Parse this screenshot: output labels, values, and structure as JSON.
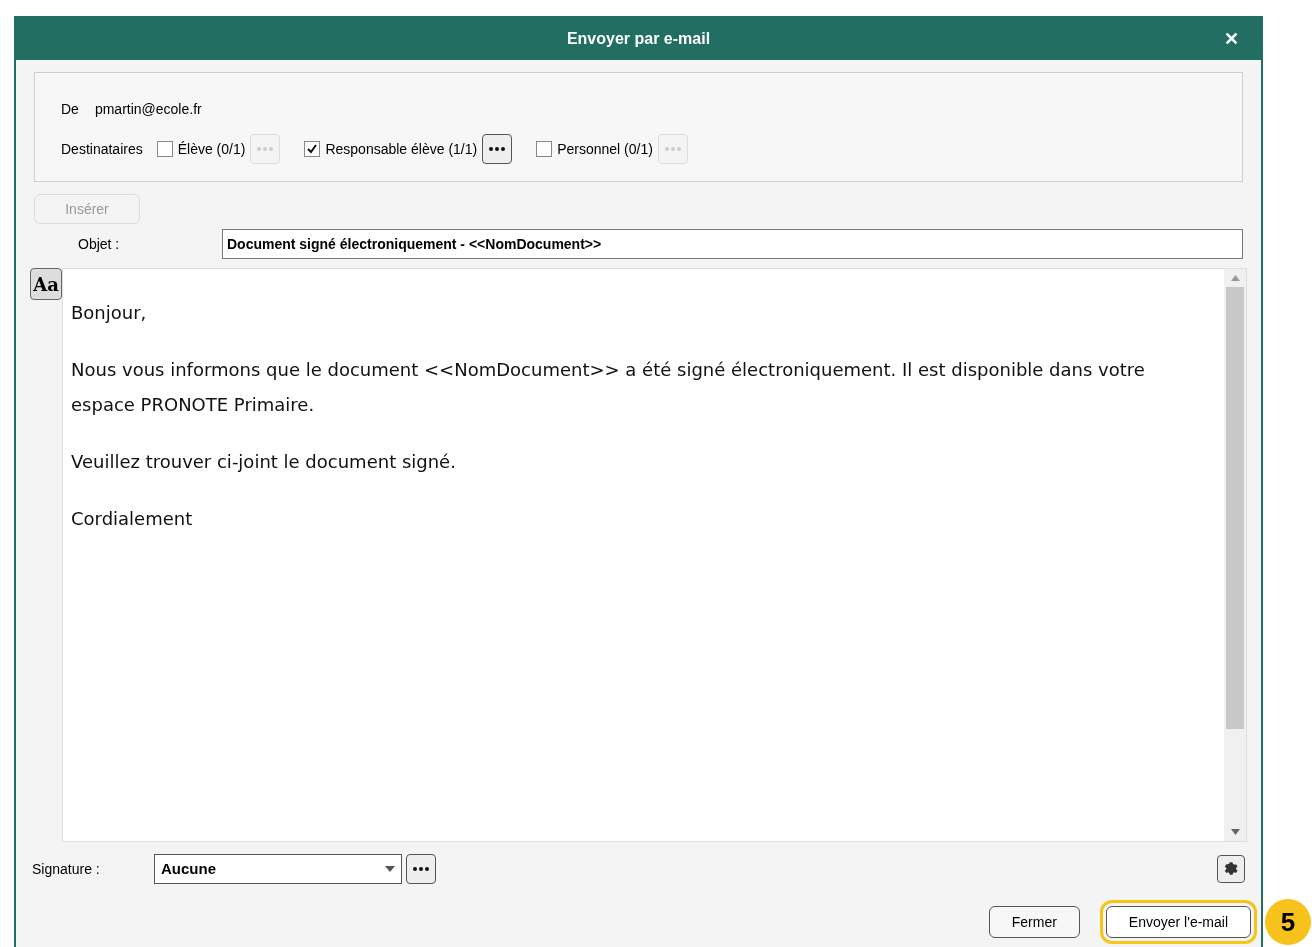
{
  "window": {
    "title": "Envoyer par e-mail",
    "close": "✕"
  },
  "from": {
    "label": "De",
    "value": "pmartin@ecole.fr"
  },
  "recipients": {
    "label": "Destinataires",
    "groups": [
      {
        "label": "Élève (0/1)",
        "checked": false
      },
      {
        "label": "Responsable élève (1/1)",
        "checked": true
      },
      {
        "label": "Personnel (0/1)",
        "checked": false
      }
    ]
  },
  "insert_button": {
    "label": "Insérer",
    "disabled": true
  },
  "subject": {
    "label": "Objet :",
    "value": "Document signé électroniquement - <<NomDocument>>"
  },
  "format_button": "Aa",
  "body": [
    "Bonjour,",
    "Nous vous informons que le document <<NomDocument>> a été signé électroniquement. Il est disponible dans votre espace PRONOTE Primaire.",
    "Veuillez trouver ci-joint le document signé.",
    "Cordialement"
  ],
  "signature": {
    "label": "Signature :",
    "value": "Aucune"
  },
  "buttons": [
    {
      "label": "Fermer",
      "highlighted": false
    },
    {
      "label": "Envoyer l'e-mail",
      "highlighted": true
    }
  ],
  "callout": "5"
}
